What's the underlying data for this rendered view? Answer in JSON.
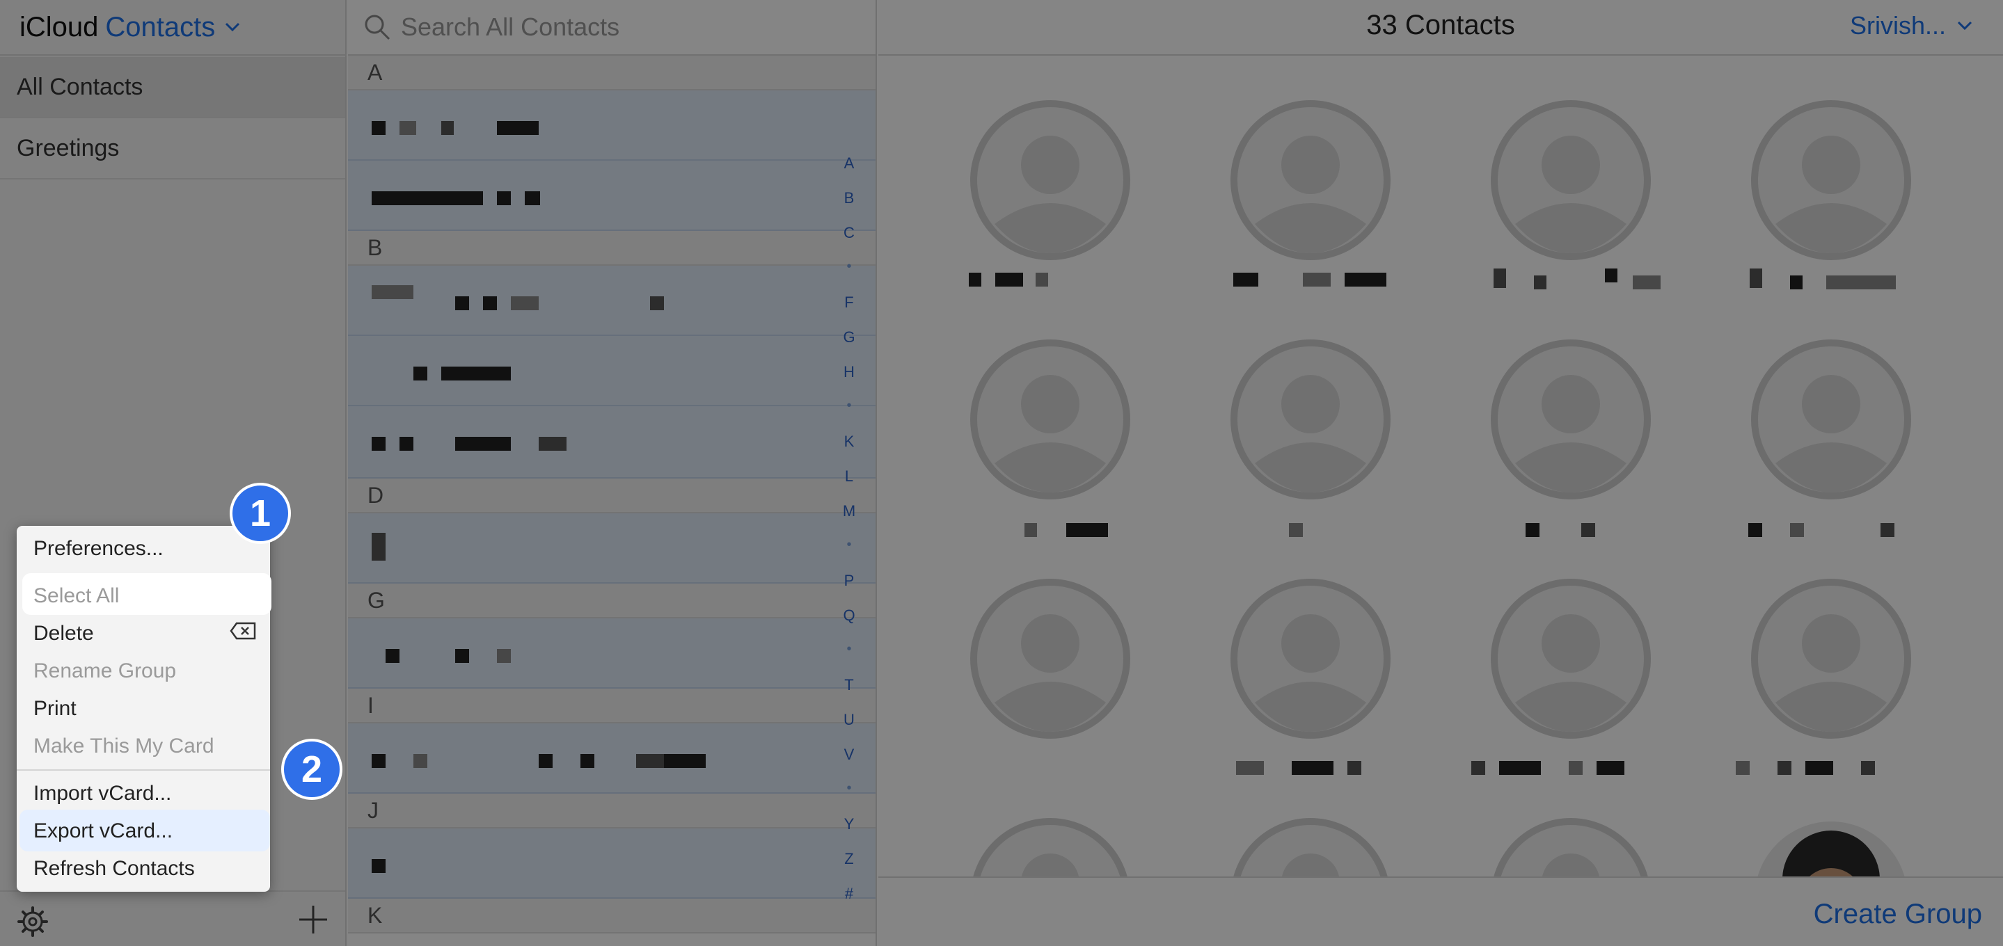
{
  "brand": {
    "prefix": "iCloud",
    "app": "Contacts"
  },
  "sidebar": {
    "groups": [
      {
        "label": "All Contacts",
        "active": true
      },
      {
        "label": "Greetings",
        "active": false
      }
    ],
    "gear_icon": "gear-icon",
    "add_icon": "plus-icon"
  },
  "search": {
    "placeholder": "Search All Contacts"
  },
  "list": {
    "sections": [
      "A",
      "B",
      "D",
      "G",
      "I",
      "J",
      "K"
    ],
    "index": [
      "A",
      "B",
      "C",
      "•",
      "F",
      "G",
      "H",
      "•",
      "K",
      "L",
      "M",
      "•",
      "P",
      "Q",
      "•",
      "T",
      "U",
      "V",
      "•",
      "Y",
      "Z",
      "#"
    ]
  },
  "cards": {
    "count_label": "33 Contacts",
    "account": "Srivish...",
    "create_group": "Create Group"
  },
  "menu": {
    "items": [
      {
        "label": "Preferences...",
        "enabled": true
      },
      {
        "label": "Select All",
        "enabled": true,
        "highlighted": true
      },
      {
        "label": "Delete",
        "enabled": true
      },
      {
        "label": "Rename Group",
        "enabled": false
      },
      {
        "label": "Print",
        "enabled": true
      },
      {
        "label": "Make This My Card",
        "enabled": false
      },
      {
        "label": "Import vCard...",
        "enabled": true
      },
      {
        "label": "Export vCard...",
        "enabled": true,
        "highlighted": true
      },
      {
        "label": "Refresh Contacts",
        "enabled": true
      }
    ]
  },
  "steps": {
    "first": "1",
    "second": "2"
  },
  "colors": {
    "accent": "#1e6fe6",
    "badge": "#2f6fe8",
    "selection": "#dfeaf7"
  }
}
